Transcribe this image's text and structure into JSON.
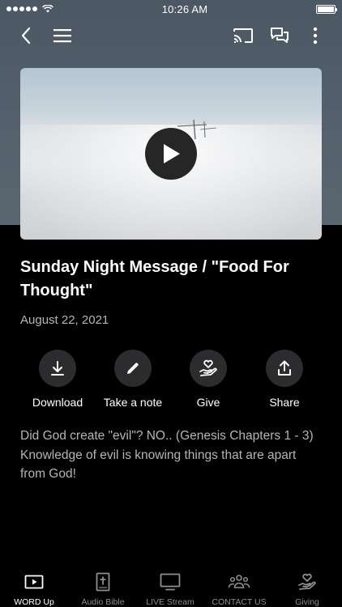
{
  "status_bar": {
    "time": "10:26 AM"
  },
  "nav": {
    "back_icon": "chevron-left-icon",
    "menu_icon": "hamburger-menu-icon",
    "cast_icon": "cast-icon",
    "chat_icon": "chat-bubbles-icon",
    "more_icon": "more-vertical-icon"
  },
  "media": {
    "title": "Sunday Night Message / \"Food For Thought\"",
    "date": "August 22, 2021",
    "description_lines": [
      "Did God create \"evil\"? NO.. (Genesis Chapters 1 - 3)",
      "Knowledge of evil is knowing things that are apart from God!"
    ]
  },
  "actions": [
    {
      "label": "Download",
      "icon": "download-icon"
    },
    {
      "label": "Take a note",
      "icon": "pencil-icon"
    },
    {
      "label": "Give",
      "icon": "heart-hand-icon"
    },
    {
      "label": "Share",
      "icon": "share-icon"
    }
  ],
  "tabs": [
    {
      "label": "WORD Up",
      "icon": "video-icon",
      "active": true
    },
    {
      "label": "Audio Bible",
      "icon": "bible-icon",
      "active": false
    },
    {
      "label": "LIVE Stream",
      "icon": "tv-icon",
      "active": false
    },
    {
      "label": "CONTACT US",
      "icon": "people-icon",
      "active": false
    },
    {
      "label": "Giving",
      "icon": "heart-hand-icon",
      "active": false
    }
  ],
  "colors": {
    "background": "#000000",
    "header_background": "#55616c",
    "action_circle": "#2c2c2e",
    "secondary_text": "#b5b5b5",
    "inactive_tab": "#8e8e93"
  }
}
